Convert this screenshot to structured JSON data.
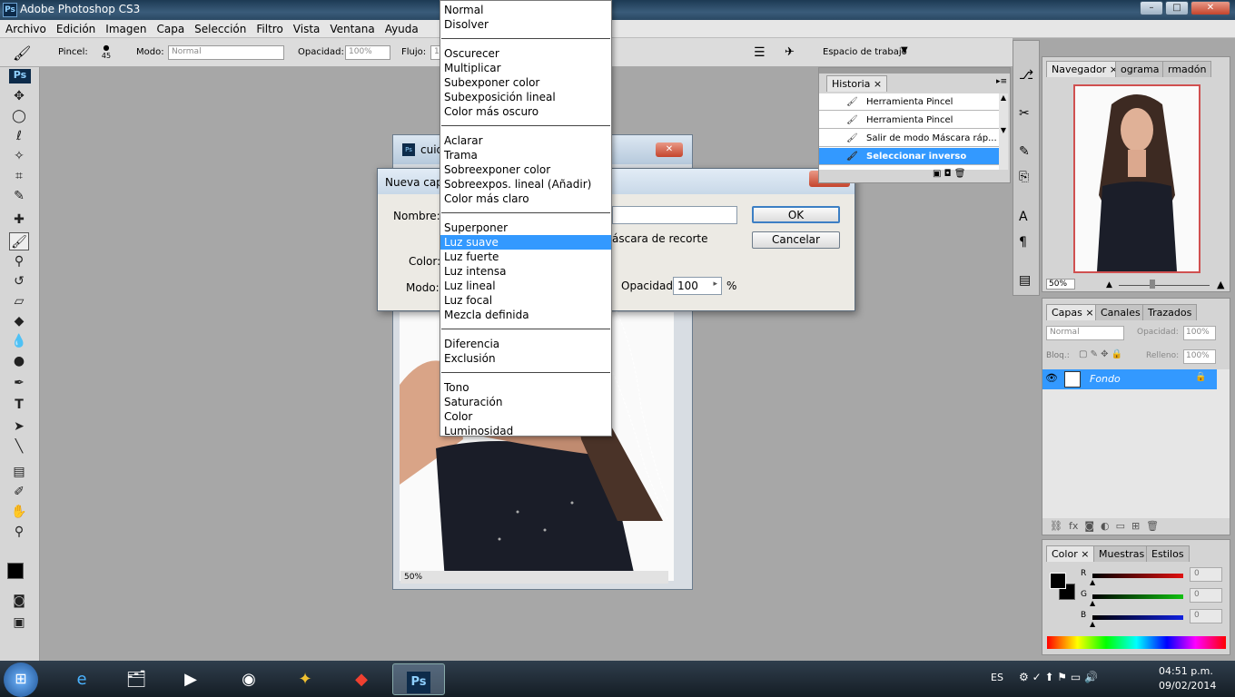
{
  "app": {
    "title": "Adobe Photoshop CS3",
    "logo": "Ps"
  },
  "window_controls": {
    "minimize": "–",
    "maximize": "□",
    "close": "✕"
  },
  "menubar": [
    "Archivo",
    "Edición",
    "Imagen",
    "Capa",
    "Selección",
    "Filtro",
    "Vista",
    "Ventana",
    "Ayuda"
  ],
  "options": {
    "brush_label": "Pincel:",
    "brush_size": "45",
    "mode_label": "Modo:",
    "mode_value": "Normal",
    "opacity_label": "Opacidad:",
    "opacity_value": "100%",
    "flow_label": "Flujo:",
    "flow_value": "10",
    "workspace_label": "Espacio de trabajo"
  },
  "document": {
    "title": "cuid",
    "zoom": "50%"
  },
  "dialog": {
    "title": "Nueva capa",
    "name_label": "Nombre:",
    "color_label": "Color:",
    "mode_label": "Modo:",
    "clipping_text": "áscara de recorte",
    "opacity_label": "Opacidad:",
    "opacity_value": "100",
    "percent": "%",
    "ok_label": "OK",
    "cancel_label": "Cancelar"
  },
  "blend_modes": [
    [
      "Normal",
      "Disolver"
    ],
    [
      "Oscurecer",
      "Multiplicar",
      "Subexponer color",
      "Subexposición lineal",
      "Color más oscuro"
    ],
    [
      "Aclarar",
      "Trama",
      "Sobreexponer color",
      "Sobreexpos. lineal (Añadir)",
      "Color más claro"
    ],
    [
      "Superponer",
      "Luz suave",
      "Luz fuerte",
      "Luz intensa",
      "Luz lineal",
      "Luz focal",
      "Mezcla definida"
    ],
    [
      "Diferencia",
      "Exclusión"
    ],
    [
      "Tono",
      "Saturación",
      "Color",
      "Luminosidad"
    ]
  ],
  "selected_blend_mode": "Luz suave",
  "history": {
    "tab": "Historia",
    "items": [
      "Herramienta Pincel",
      "Herramienta Pincel",
      "Salir de modo Máscara ráp...",
      "Seleccionar inverso"
    ],
    "active_index": 3
  },
  "navigator": {
    "tabs": [
      "Navegador",
      "ograma",
      "rmadón"
    ],
    "zoom": "50%"
  },
  "layers": {
    "tabs": [
      "Capas",
      "Canales",
      "Trazados"
    ],
    "mode": "Normal",
    "opacity_label": "Opacidad:",
    "opacity_value": "100%",
    "lock_label": "Bloq.:",
    "fill_label": "Relleno:",
    "fill_value": "100%",
    "layer_name": "Fondo"
  },
  "color_panel": {
    "tabs": [
      "Color",
      "Muestras",
      "Estilos"
    ],
    "channels": [
      {
        "label": "R",
        "value": "0",
        "color": "#e01010"
      },
      {
        "label": "G",
        "value": "0",
        "color": "#10c010"
      },
      {
        "label": "B",
        "value": "0",
        "color": "#1020e0"
      }
    ]
  },
  "taskbar": {
    "language": "ES",
    "time": "04:51 p.m.",
    "date": "09/02/2014",
    "apps": [
      "windows-explorer",
      "internet-explorer",
      "file-explorer",
      "media-player",
      "chrome",
      "app-yellow",
      "app-red",
      "photoshop"
    ]
  }
}
